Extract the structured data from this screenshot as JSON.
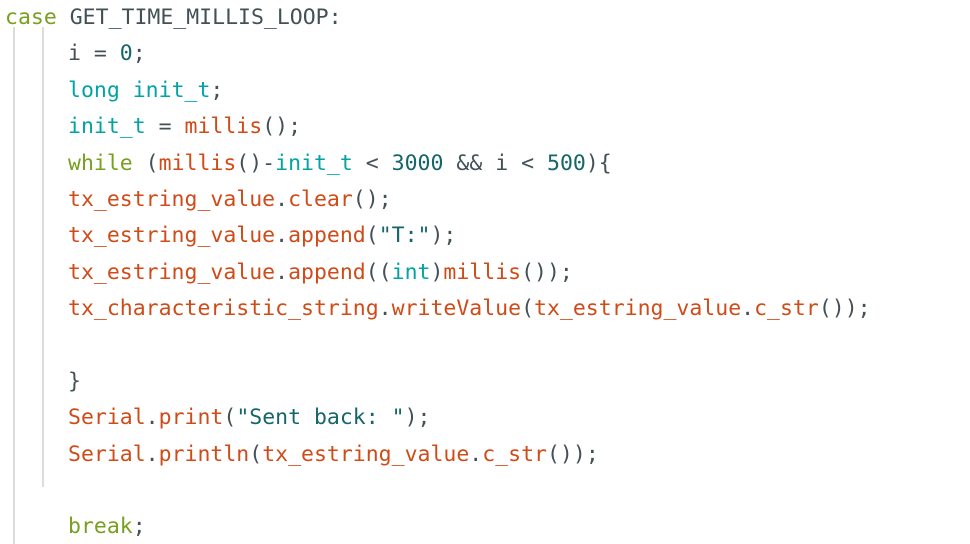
{
  "editor": {
    "language": "cpp",
    "background_color": "#ffffff",
    "indent_guide_color": "#dcdcdc",
    "font": "monospace",
    "theme_colors": {
      "keyword": "#789f1f",
      "type": "#03a3a3",
      "plain": "#435157",
      "function": "#cf4b18",
      "number": "#15666b",
      "string": "#15666b"
    }
  },
  "code": {
    "lines": [
      {
        "index": 1,
        "indent": 0,
        "text": "case GET_TIME_MILLIS_LOOP:",
        "tokens": [
          {
            "t": "case",
            "c": "kw"
          },
          {
            "t": " ",
            "c": "plain"
          },
          {
            "t": "GET_TIME_MILLIS_LOOP:",
            "c": "plain"
          }
        ]
      },
      {
        "index": 2,
        "indent": 1,
        "text": "i = 0;",
        "tokens": [
          {
            "t": "i ",
            "c": "plain"
          },
          {
            "t": "= ",
            "c": "plain"
          },
          {
            "t": "0",
            "c": "num"
          },
          {
            "t": ";",
            "c": "plain"
          }
        ]
      },
      {
        "index": 3,
        "indent": 1,
        "text": "long init_t;",
        "tokens": [
          {
            "t": "long",
            "c": "type"
          },
          {
            "t": " ",
            "c": "plain"
          },
          {
            "t": "init_t",
            "c": "type"
          },
          {
            "t": ";",
            "c": "plain"
          }
        ]
      },
      {
        "index": 4,
        "indent": 1,
        "text": "init_t = millis();",
        "tokens": [
          {
            "t": "init_t",
            "c": "type"
          },
          {
            "t": " = ",
            "c": "plain"
          },
          {
            "t": "millis",
            "c": "fn"
          },
          {
            "t": "();",
            "c": "plain"
          }
        ]
      },
      {
        "index": 5,
        "indent": 1,
        "text": "while (millis()-init_t < 3000 && i < 500){",
        "tokens": [
          {
            "t": "while",
            "c": "kw"
          },
          {
            "t": " (",
            "c": "plain"
          },
          {
            "t": "millis",
            "c": "fn"
          },
          {
            "t": "()-",
            "c": "plain"
          },
          {
            "t": "init_t",
            "c": "type"
          },
          {
            "t": " < ",
            "c": "plain"
          },
          {
            "t": "3000",
            "c": "num"
          },
          {
            "t": " && i < ",
            "c": "plain"
          },
          {
            "t": "500",
            "c": "num"
          },
          {
            "t": "){",
            "c": "plain"
          }
        ]
      },
      {
        "index": 6,
        "indent": 1,
        "text": "tx_estring_value.clear();",
        "tokens": [
          {
            "t": "tx_estring_value",
            "c": "fn"
          },
          {
            "t": ".",
            "c": "plain"
          },
          {
            "t": "clear",
            "c": "fn"
          },
          {
            "t": "();",
            "c": "plain"
          }
        ]
      },
      {
        "index": 7,
        "indent": 1,
        "text": "tx_estring_value.append(\"T:\");",
        "tokens": [
          {
            "t": "tx_estring_value",
            "c": "fn"
          },
          {
            "t": ".",
            "c": "plain"
          },
          {
            "t": "append",
            "c": "fn"
          },
          {
            "t": "(",
            "c": "plain"
          },
          {
            "t": "\"T:\"",
            "c": "str"
          },
          {
            "t": ");",
            "c": "plain"
          }
        ]
      },
      {
        "index": 8,
        "indent": 1,
        "text": "tx_estring_value.append((int)millis());",
        "tokens": [
          {
            "t": "tx_estring_value",
            "c": "fn"
          },
          {
            "t": ".",
            "c": "plain"
          },
          {
            "t": "append",
            "c": "fn"
          },
          {
            "t": "((",
            "c": "plain"
          },
          {
            "t": "int",
            "c": "type"
          },
          {
            "t": ")",
            "c": "plain"
          },
          {
            "t": "millis",
            "c": "fn"
          },
          {
            "t": "());",
            "c": "plain"
          }
        ]
      },
      {
        "index": 9,
        "indent": 1,
        "text": "tx_characteristic_string.writeValue(tx_estring_value.c_str());",
        "tokens": [
          {
            "t": "tx_characteristic_string",
            "c": "fn"
          },
          {
            "t": ".",
            "c": "plain"
          },
          {
            "t": "writeValue",
            "c": "fn"
          },
          {
            "t": "(",
            "c": "plain"
          },
          {
            "t": "tx_estring_value",
            "c": "fn"
          },
          {
            "t": ".",
            "c": "plain"
          },
          {
            "t": "c_str",
            "c": "fn"
          },
          {
            "t": "());",
            "c": "plain"
          }
        ]
      },
      {
        "index": 10,
        "indent": 1,
        "text": "",
        "tokens": []
      },
      {
        "index": 11,
        "indent": 1,
        "text": "}",
        "tokens": [
          {
            "t": "}",
            "c": "plain"
          }
        ]
      },
      {
        "index": 12,
        "indent": 1,
        "text": "Serial.print(\"Sent back: \");",
        "tokens": [
          {
            "t": "Serial",
            "c": "fn"
          },
          {
            "t": ".",
            "c": "plain"
          },
          {
            "t": "print",
            "c": "fn"
          },
          {
            "t": "(",
            "c": "plain"
          },
          {
            "t": "\"Sent back: \"",
            "c": "str"
          },
          {
            "t": ");",
            "c": "plain"
          }
        ]
      },
      {
        "index": 13,
        "indent": 1,
        "text": "Serial.println(tx_estring_value.c_str());",
        "tokens": [
          {
            "t": "Serial",
            "c": "fn"
          },
          {
            "t": ".",
            "c": "plain"
          },
          {
            "t": "println",
            "c": "fn"
          },
          {
            "t": "(",
            "c": "plain"
          },
          {
            "t": "tx_estring_value",
            "c": "fn"
          },
          {
            "t": ".",
            "c": "plain"
          },
          {
            "t": "c_str",
            "c": "fn"
          },
          {
            "t": "());",
            "c": "plain"
          }
        ]
      },
      {
        "index": 14,
        "indent": 1,
        "text": "",
        "tokens": []
      },
      {
        "index": 15,
        "indent": 1,
        "text": "break;",
        "tokens": [
          {
            "t": "break",
            "c": "kw"
          },
          {
            "t": ";",
            "c": "plain"
          }
        ]
      }
    ]
  }
}
